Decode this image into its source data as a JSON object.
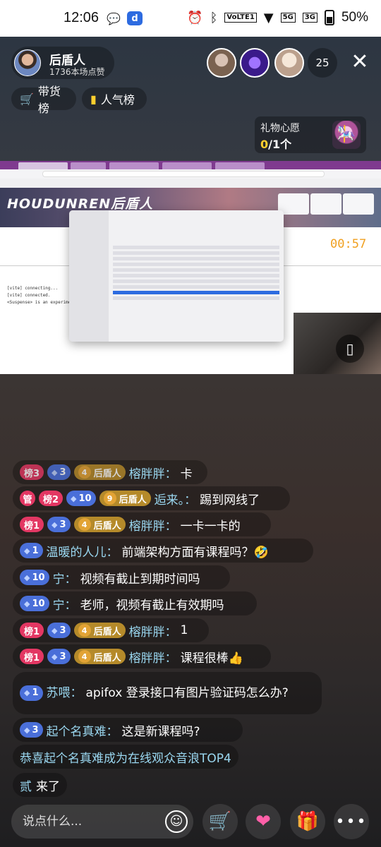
{
  "status_bar": {
    "time": "12:06",
    "battery": "50%",
    "net1": "5G",
    "net2": "3G",
    "volte": "VoLTE1"
  },
  "header": {
    "host_name": "后盾人",
    "host_likes": "1736本场点赞",
    "viewer_count": "25",
    "sales_rank_label": "带货榜",
    "popularity_rank_label": "人气榜"
  },
  "gift_wish": {
    "title": "礼物心愿",
    "current": "0",
    "total": "/1个"
  },
  "stream": {
    "banner_title": "HOUDUNREN后盾人",
    "timer": "00:57",
    "console_lines": [
      "[vite] connecting...",
      "[vite] connected.",
      "<Suspense> is an experimental"
    ]
  },
  "messages": [
    {
      "rank": "榜3",
      "level": "3",
      "fan_level": "4",
      "fan_name": "后盾人",
      "user": "榕胖胖：",
      "text": "卡"
    },
    {
      "mgr": "管",
      "rank": "榜2",
      "level": "10",
      "fan_level": "9",
      "fan_name": "后盾人",
      "user": "逅来。：",
      "text": "踢到网线了"
    },
    {
      "rank": "榜1",
      "level": "3",
      "fan_level": "4",
      "fan_name": "后盾人",
      "user": "榕胖胖：",
      "text": "一卡一卡的"
    },
    {
      "level": "1",
      "user": "温暖的人儿：",
      "text": "前端架构方面有课程吗？🤣"
    },
    {
      "level": "10",
      "user": "宁：",
      "text": "视频有截止到期时间吗"
    },
    {
      "level": "10",
      "user": "宁：",
      "text": "老师，视频有截止有效期吗"
    },
    {
      "rank": "榜1",
      "level": "3",
      "fan_level": "4",
      "fan_name": "后盾人",
      "user": "榕胖胖：",
      "text": "1"
    },
    {
      "rank": "榜1",
      "level": "3",
      "fan_level": "4",
      "fan_name": "后盾人",
      "user": "榕胖胖：",
      "text": "课程很棒👍"
    },
    {
      "level": "1",
      "user": "苏喂：",
      "text": "apifox 登录接口有图片验证码怎么办?"
    },
    {
      "level": "3",
      "user": "起个名真难：",
      "text": "这是新课程吗?"
    }
  ],
  "notice": "恭喜起个名真难成为在线观众音浪TOP4",
  "joined": {
    "user": "贰",
    "text": "来了"
  },
  "bottom_bar": {
    "input_placeholder": "说点什么..."
  }
}
